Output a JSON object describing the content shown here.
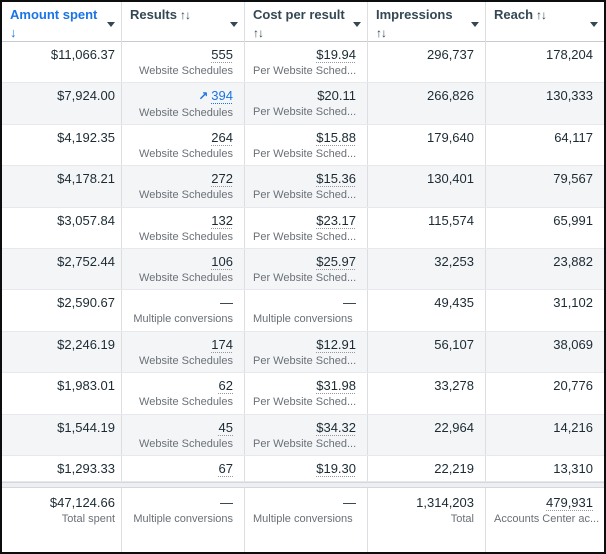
{
  "colors": {
    "accent_blue": "#1b74e4",
    "header_text": "#344854",
    "value_text": "#1c2b33",
    "subtitle_text": "#6a7077",
    "row_alt_bg": "#f4f5f7",
    "grid_border": "#dcdee2",
    "frame_border": "#0b0d0e"
  },
  "icons": {
    "trend_up": "↗",
    "caret_down": "▾"
  },
  "header": {
    "columns": [
      {
        "id": "amount-spent",
        "label": "Amount spent",
        "sort_icon": "↓",
        "sorted": true
      },
      {
        "id": "results",
        "label": "Results",
        "sort_icon": "↑↓",
        "sorted": false
      },
      {
        "id": "cost-per-result",
        "label": "Cost per result",
        "sort_icon": "↑↓",
        "sorted": false
      },
      {
        "id": "impressions",
        "label": "Impressions",
        "sort_icon": "↑↓",
        "sorted": false
      },
      {
        "id": "reach",
        "label": "Reach",
        "sort_icon": "↑↓",
        "sorted": false
      }
    ]
  },
  "rows": [
    {
      "amount": "$11,066.37",
      "results": {
        "value": "555",
        "sub": "Website Schedules",
        "link": true
      },
      "cost": {
        "value": "$19.94",
        "sub": "Per Website Sched...",
        "link": true
      },
      "impressions": "296,737",
      "reach": "178,204"
    },
    {
      "amount": "$7,924.00",
      "results": {
        "value": "394",
        "sub": "Website Schedules",
        "link": true,
        "trend": true
      },
      "cost": {
        "value": "$20.11",
        "sub": "Per Website Sched...",
        "link": false
      },
      "impressions": "266,826",
      "reach": "130,333",
      "shaded": true
    },
    {
      "amount": "$4,192.35",
      "results": {
        "value": "264",
        "sub": "Website Schedules",
        "link": true
      },
      "cost": {
        "value": "$15.88",
        "sub": "Per Website Sched...",
        "link": true
      },
      "impressions": "179,640",
      "reach": "64,117"
    },
    {
      "amount": "$4,178.21",
      "results": {
        "value": "272",
        "sub": "Website Schedules",
        "link": true
      },
      "cost": {
        "value": "$15.36",
        "sub": "Per Website Sched...",
        "link": true
      },
      "impressions": "130,401",
      "reach": "79,567",
      "shaded": true
    },
    {
      "amount": "$3,057.84",
      "results": {
        "value": "132",
        "sub": "Website Schedules",
        "link": true
      },
      "cost": {
        "value": "$23.17",
        "sub": "Per Website Sched...",
        "link": true
      },
      "impressions": "115,574",
      "reach": "65,991"
    },
    {
      "amount": "$2,752.44",
      "results": {
        "value": "106",
        "sub": "Website Schedules",
        "link": true
      },
      "cost": {
        "value": "$25.97",
        "sub": "Per Website Sched...",
        "link": true
      },
      "impressions": "32,253",
      "reach": "23,882",
      "shaded": true
    },
    {
      "amount": "$2,590.67",
      "results": {
        "value": "—",
        "sub": "Multiple conversions",
        "link": false
      },
      "cost": {
        "value": "—",
        "sub": "Multiple conversions",
        "link": false
      },
      "impressions": "49,435",
      "reach": "31,102"
    },
    {
      "amount": "$2,246.19",
      "results": {
        "value": "174",
        "sub": "Website Schedules",
        "link": true
      },
      "cost": {
        "value": "$12.91",
        "sub": "Per Website Sched...",
        "link": true
      },
      "impressions": "56,107",
      "reach": "38,069",
      "shaded": true
    },
    {
      "amount": "$1,983.01",
      "results": {
        "value": "62",
        "sub": "Website Schedules",
        "link": true
      },
      "cost": {
        "value": "$31.98",
        "sub": "Per Website Sched...",
        "link": true
      },
      "impressions": "33,278",
      "reach": "20,776"
    },
    {
      "amount": "$1,544.19",
      "results": {
        "value": "45",
        "sub": "Website Schedules",
        "link": true
      },
      "cost": {
        "value": "$34.32",
        "sub": "Per Website Sched...",
        "link": true
      },
      "impressions": "22,964",
      "reach": "14,216",
      "shaded": true
    },
    {
      "amount": "$1,293.33",
      "results": {
        "value": "67",
        "sub": "",
        "link": true
      },
      "cost": {
        "value": "$19.30",
        "sub": "",
        "link": true
      },
      "impressions": "22,219",
      "reach": "13,310",
      "short": true
    }
  ],
  "total_row": {
    "amount": {
      "value": "$47,124.66",
      "sub": "Total spent"
    },
    "results": {
      "value": "—",
      "sub": "Multiple conversions"
    },
    "cost": {
      "value": "—",
      "sub": "Multiple conversions"
    },
    "impressions": {
      "value": "1,314,203",
      "sub": "Total"
    },
    "reach": {
      "value": "479,931",
      "sub": "Accounts Center ac...",
      "link": true
    }
  }
}
